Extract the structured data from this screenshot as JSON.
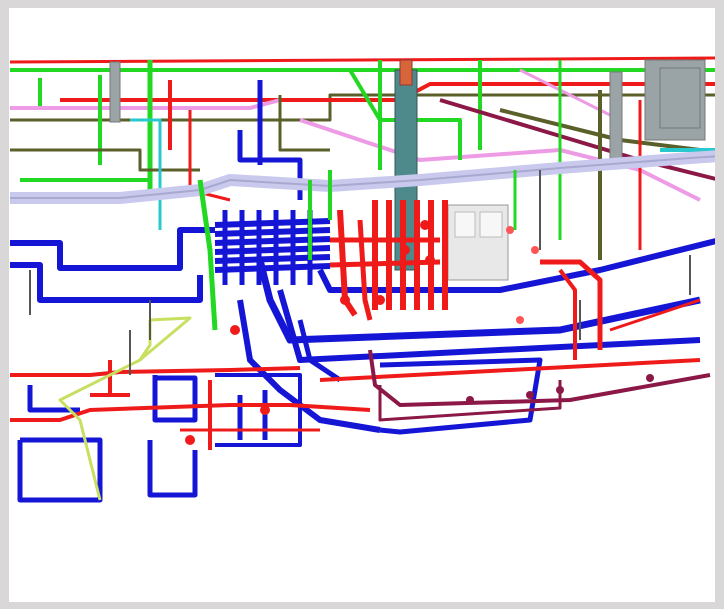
{
  "colors": {
    "frame": "#d9d7d7",
    "background": "#ffffff",
    "supply_pipe": "#1515d6",
    "fire_pipe": "#ef1b1b",
    "return_pipe": "#8b1846",
    "green_pipe": "#22d822",
    "main_duct": "#c9c9ee",
    "pink_pipe": "#ee9be6",
    "olive_pipe": "#5b5f2a",
    "cyan_pipe": "#27c9cf",
    "lime_pipe": "#c7e060",
    "steel_grey": "#9aa3a6",
    "equipment": "#e8e8e8",
    "teal_column": "#4e8a8c"
  }
}
